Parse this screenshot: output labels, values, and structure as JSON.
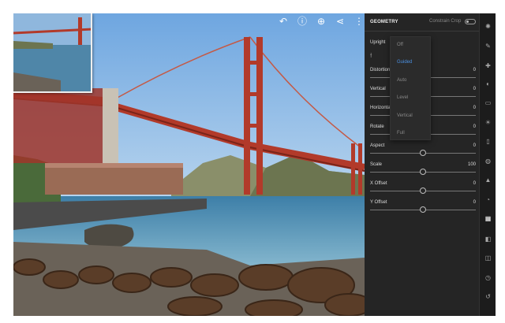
{
  "toolbar": {
    "icons": [
      "undo-icon",
      "info-icon",
      "add-icon",
      "share-icon",
      "more-icon"
    ]
  },
  "panel": {
    "title": "GEOMETRY",
    "constrain_label": "Constrain Crop",
    "constrain_on": false,
    "upright_label": "Upright",
    "rows": [
      {
        "label": "Distortion",
        "value": "0",
        "fraction": 0.5
      },
      {
        "label": "Vertical",
        "value": "0",
        "fraction": 0.5
      },
      {
        "label": "Horizontal",
        "value": "0",
        "fraction": 0.5
      },
      {
        "label": "Rotate",
        "value": "0",
        "fraction": 0.5
      },
      {
        "label": "Aspect",
        "value": "0",
        "fraction": 0.5
      },
      {
        "label": "Scale",
        "value": "100",
        "fraction": 0.5
      },
      {
        "label": "X Offset",
        "value": "0",
        "fraction": 0.5
      },
      {
        "label": "Y Offset",
        "value": "0",
        "fraction": 0.5
      }
    ]
  },
  "dropdown": {
    "options": [
      "Off",
      "Guided",
      "Auto",
      "Level",
      "Vertical",
      "Full"
    ],
    "selected": "Guided"
  },
  "rail": {
    "icons": [
      "presets-icon",
      "brush-icon",
      "heal-icon",
      "mask-icon",
      "crop-icon",
      "light-icon",
      "color-icon",
      "vignette-icon",
      "detail-icon",
      "optics-icon",
      "geometry-icon",
      "versions-icon",
      "profile-icon",
      "history-icon",
      "reset-icon"
    ]
  },
  "colors": {
    "panel_bg": "#252525",
    "accent": "#4a90e2",
    "bridge": "#b23a2a"
  }
}
